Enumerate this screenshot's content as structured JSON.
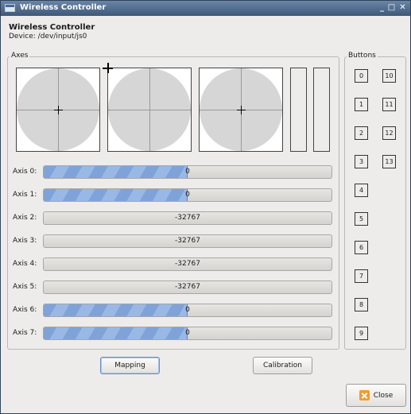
{
  "window": {
    "title": "Wireless Controller",
    "controls": {
      "minimize": "_",
      "maximize": "□",
      "close": "✕"
    }
  },
  "header": {
    "title": "Wireless Controller",
    "device": "Device: /dev/input/js0"
  },
  "axes_group": {
    "label": "Axes"
  },
  "buttons_group": {
    "label": "Buttons"
  },
  "axes": [
    {
      "label": "Axis 0:",
      "value": "0",
      "fill": 0.5
    },
    {
      "label": "Axis 1:",
      "value": "0",
      "fill": 0.5
    },
    {
      "label": "Axis 2:",
      "value": "-32767",
      "fill": 0
    },
    {
      "label": "Axis 3:",
      "value": "-32767",
      "fill": 0
    },
    {
      "label": "Axis 4:",
      "value": "-32767",
      "fill": 0
    },
    {
      "label": "Axis 5:",
      "value": "-32767",
      "fill": 0
    },
    {
      "label": "Axis 6:",
      "value": "0",
      "fill": 0.5
    },
    {
      "label": "Axis 7:",
      "value": "0",
      "fill": 0.5
    }
  ],
  "buttons": [
    "0",
    "1",
    "2",
    "3",
    "4",
    "5",
    "6",
    "7",
    "8",
    "9",
    "10",
    "11",
    "12",
    "13"
  ],
  "actions": {
    "mapping": "Mapping",
    "calibration": "Calibration",
    "close": "Close"
  },
  "colors": {
    "accent": "#7fa3d9",
    "titlebar": "#4f6a8c",
    "close_icon": "#f29b2e"
  }
}
